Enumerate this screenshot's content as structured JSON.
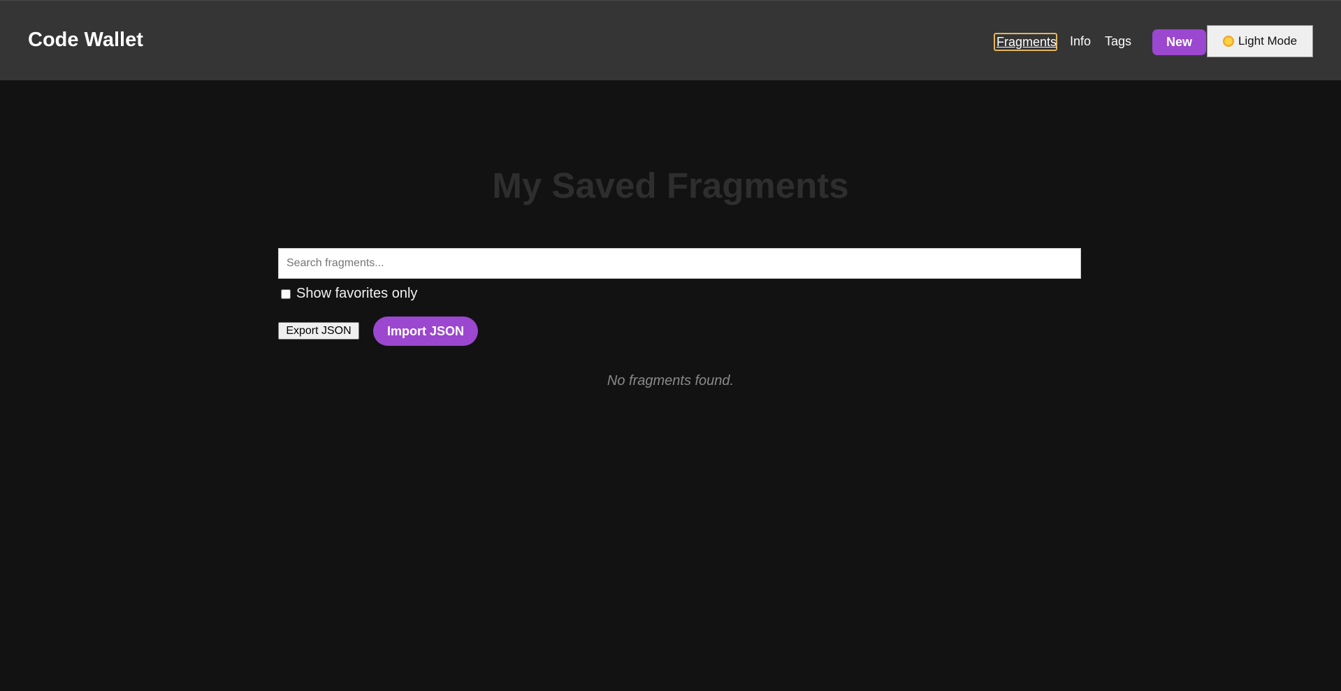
{
  "header": {
    "brand": "Code Wallet",
    "nav": {
      "fragments": "Fragments",
      "info": "Info",
      "tags": "Tags"
    },
    "new_button": "New",
    "theme_button": "Light Mode",
    "theme_icon": "sun-icon"
  },
  "main": {
    "title": "My Saved Fragments",
    "search_placeholder": "Search fragments...",
    "search_value": "",
    "favorites_label": "Show favorites only",
    "favorites_checked": false,
    "export_label": "Export JSON",
    "import_label": "Import JSON",
    "empty_message": "No fragments found."
  },
  "colors": {
    "header_bg": "#353535",
    "page_bg": "#121212",
    "accent": "#9b47cf",
    "focus_ring": "#e5b45c"
  }
}
